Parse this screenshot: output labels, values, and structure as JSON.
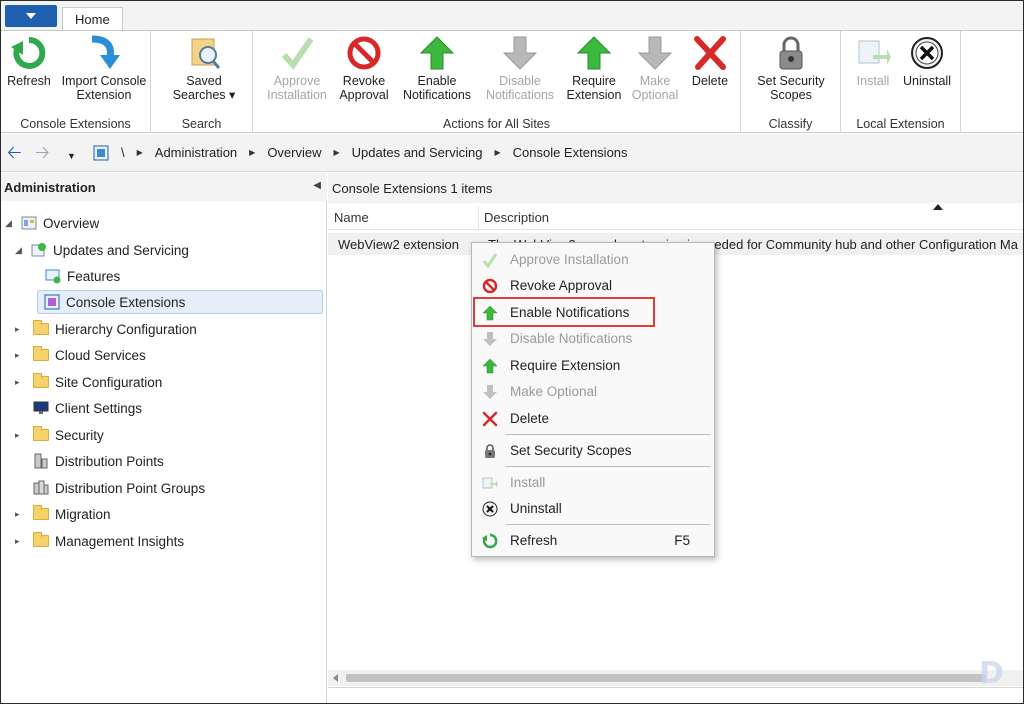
{
  "ribbon": {
    "tab_home": "Home",
    "groups": {
      "console_extensions": {
        "label": "Console Extensions",
        "refresh": "Refresh",
        "import_line1": "Import Console",
        "import_line2": "Extension"
      },
      "search": {
        "label": "Search",
        "saved_line1": "Saved",
        "saved_line2": "Searches ▾"
      },
      "actions": {
        "label": "Actions for All Sites",
        "approve_line1": "Approve",
        "approve_line2": "Installation",
        "revoke_line1": "Revoke",
        "revoke_line2": "Approval",
        "enable_line1": "Enable",
        "enable_line2": "Notifications",
        "disable_line1": "Disable",
        "disable_line2": "Notifications",
        "require_line1": "Require",
        "require_line2": "Extension",
        "optional_line1": "Make",
        "optional_line2": "Optional",
        "delete": "Delete"
      },
      "classify": {
        "label": "Classify",
        "scopes_line1": "Set Security",
        "scopes_line2": "Scopes"
      },
      "local_extension": {
        "label": "Local Extension",
        "install": "Install",
        "uninstall": "Uninstall"
      }
    }
  },
  "address": {
    "root": "\\",
    "crumbs": [
      "Administration",
      "Overview",
      "Updates and Servicing",
      "Console Extensions"
    ]
  },
  "nav": {
    "title": "Administration",
    "items": [
      {
        "label": "Overview"
      },
      {
        "label": "Updates and Servicing"
      },
      {
        "label": "Features"
      },
      {
        "label": "Console Extensions"
      },
      {
        "label": "Hierarchy Configuration"
      },
      {
        "label": "Cloud Services"
      },
      {
        "label": "Site Configuration"
      },
      {
        "label": "Client Settings"
      },
      {
        "label": "Security"
      },
      {
        "label": "Distribution Points"
      },
      {
        "label": "Distribution Point Groups"
      },
      {
        "label": "Migration"
      },
      {
        "label": "Management Insights"
      }
    ]
  },
  "list": {
    "header": "Console Extensions 1 items",
    "columns": [
      "Name",
      "Description"
    ],
    "rows": [
      {
        "name": "WebView2 extension",
        "description": "The WebView2 console extension is needed for Community hub and other Configuration Ma"
      }
    ]
  },
  "context_menu": {
    "items": [
      {
        "label": "Approve Installation",
        "enabled": false
      },
      {
        "label": "Revoke Approval",
        "enabled": true
      },
      {
        "label": "Enable Notifications",
        "enabled": true,
        "highlighted": true
      },
      {
        "label": "Disable Notifications",
        "enabled": false
      },
      {
        "label": "Require Extension",
        "enabled": true
      },
      {
        "label": "Make Optional",
        "enabled": false
      },
      {
        "label": "Delete",
        "enabled": true
      },
      {
        "label": "Set Security Scopes",
        "enabled": true
      },
      {
        "label": "Install",
        "enabled": false
      },
      {
        "label": "Uninstall",
        "enabled": true
      },
      {
        "label": "Refresh",
        "enabled": true,
        "shortcut": "F5"
      }
    ]
  },
  "colors": {
    "accent_blue": "#1f5fb0",
    "highlight_red": "#e23b3b",
    "green_arrow": "#3cb83c",
    "disabled_gray": "#a5a5a5"
  }
}
